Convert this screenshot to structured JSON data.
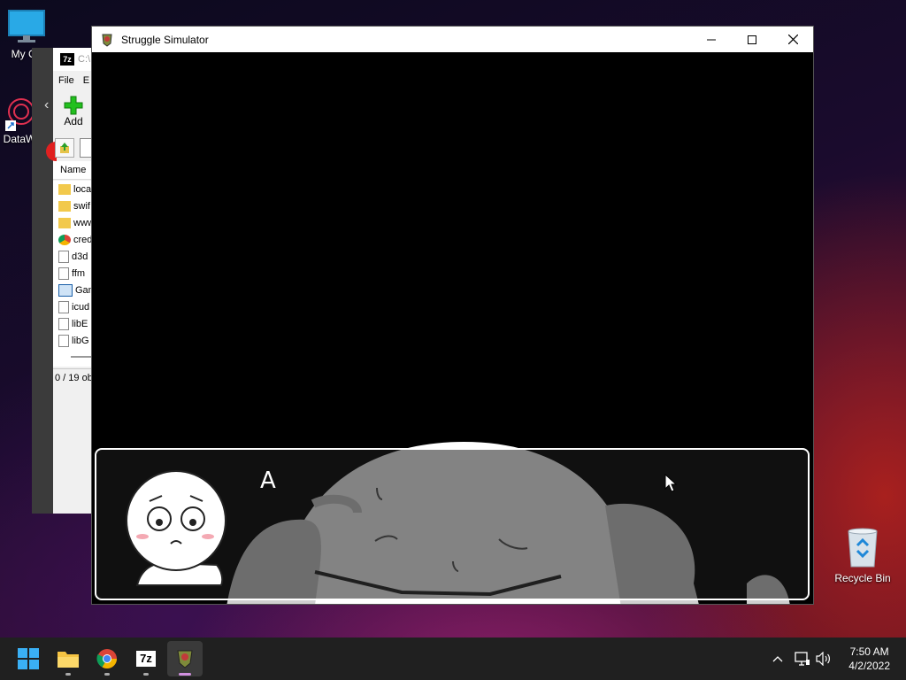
{
  "desktop": {
    "icons": [
      {
        "label": "My Co"
      },
      {
        "label": "DataW"
      },
      {
        "label": "Recycle Bin"
      }
    ]
  },
  "sevenzip": {
    "title_fragment": "C:\\",
    "menu_file": "File",
    "menu_edit": "E",
    "add_label": "Add",
    "column_name": "Name",
    "files": [
      "loca",
      "swif",
      "www",
      "cred",
      "d3d",
      "ffm",
      "Gan",
      "icud",
      "libE",
      "libG"
    ],
    "status": "0 / 19 ob"
  },
  "game": {
    "window_title": "Struggle Simulator",
    "speaker": "A"
  },
  "taskbar": {
    "apps": [
      "start-button",
      "file-explorer",
      "chrome",
      "7-zip",
      "struggle-simulator"
    ],
    "time": "7:50 AM",
    "date": "4/2/2022"
  },
  "colors": {
    "accent": "#d291e0",
    "taskbar": "#202020",
    "add_green": "#22c01e"
  }
}
